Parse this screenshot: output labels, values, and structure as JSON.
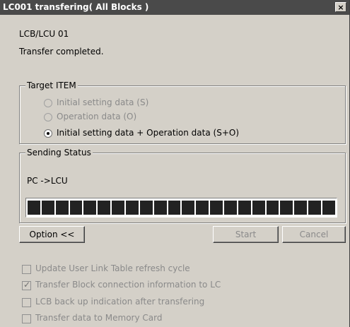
{
  "window": {
    "title": "LC001 transfering( All Blocks )",
    "close_glyph": "×"
  },
  "header": {
    "device": "LCB/LCU 01",
    "status": "Transfer completed."
  },
  "target_item": {
    "legend": "Target ITEM",
    "options": [
      {
        "label": "Initial setting data (S)",
        "selected": false,
        "enabled": false
      },
      {
        "label": "Operation data (O)",
        "selected": false,
        "enabled": false
      },
      {
        "label": "Initial setting data + Operation data (S+O)",
        "selected": true,
        "enabled": true
      }
    ]
  },
  "sending_status": {
    "legend": "Sending Status",
    "direction": "PC ->LCU",
    "progress_percent": 100,
    "segment_count": 22
  },
  "buttons": {
    "option": "Option <<",
    "start": "Start",
    "cancel": "Cancel"
  },
  "options": [
    {
      "label": "Update User Link Table refresh cycle",
      "checked": false
    },
    {
      "label": "Transfer Block connection information to LC",
      "checked": true
    },
    {
      "label": "LCB back up indication after transfering",
      "checked": false
    },
    {
      "label": "Transfer data to Memory Card",
      "checked": false
    }
  ],
  "colors": {
    "titlebar": "#4a4a4a",
    "dialog_bg": "#d4d0c8",
    "progress_fill": "#222222"
  }
}
